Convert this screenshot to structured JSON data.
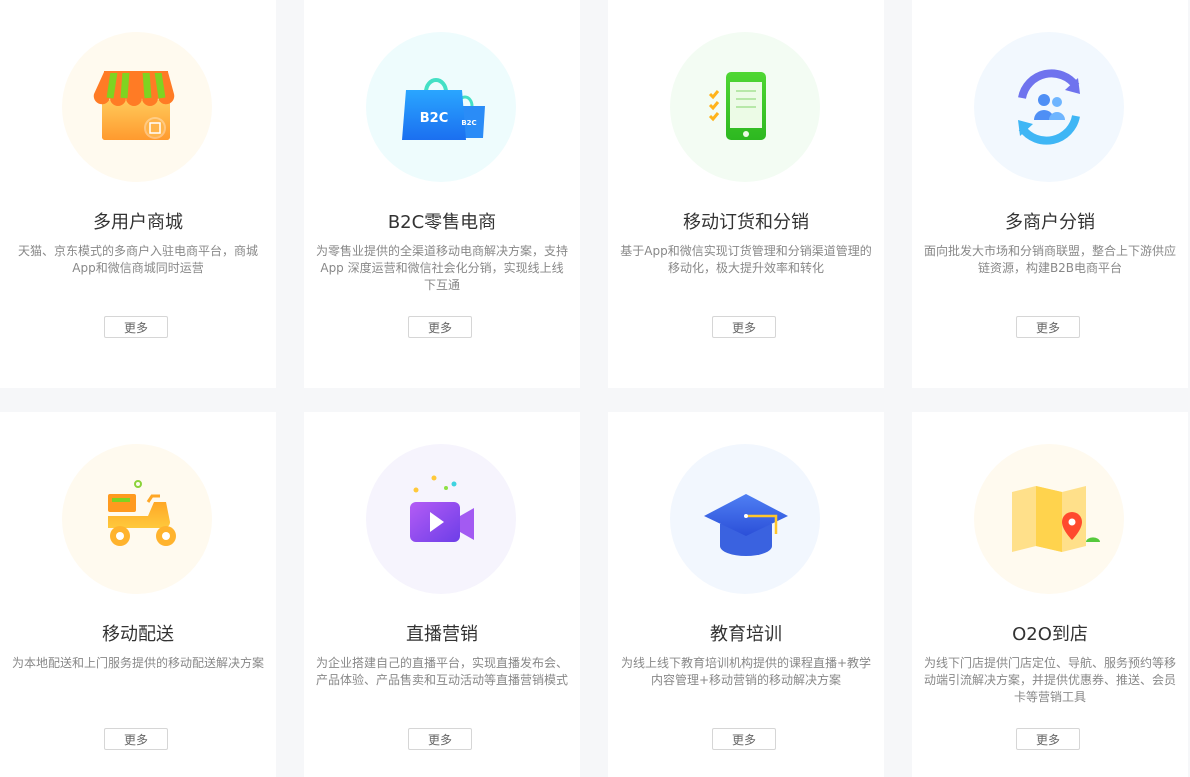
{
  "cards": [
    {
      "title": "多用户商城",
      "description": "天猫、京东模式的多商户入驻电商平台，商城App和微信商城同时运营",
      "more_label": "更多",
      "icon": "storefront-icon",
      "circle_color": "#fffaef"
    },
    {
      "title": "B2C零售电商",
      "description": "为零售业提供的全渠道移动电商解决方案，支持App 深度运营和微信社会化分销，实现线上线下互通",
      "more_label": "更多",
      "icon": "shopping-bag-icon",
      "icon_text": [
        "B2C",
        "B2C"
      ],
      "circle_color": "#eefcfd"
    },
    {
      "title": "移动订货和分销",
      "description": "基于App和微信实现订货管理和分销渠道管理的移动化，极大提升效率和转化",
      "more_label": "更多",
      "icon": "mobile-checklist-icon",
      "circle_color": "#f3fcf3"
    },
    {
      "title": "多商户分销",
      "description": "面向批发大市场和分销商联盟，整合上下游供应链资源，构建B2B电商平台",
      "more_label": "更多",
      "icon": "users-cycle-icon",
      "circle_color": "#f2f8fe"
    },
    {
      "title": "移动配送",
      "description": "为本地配送和上门服务提供的移动配送解决方案",
      "more_label": "更多",
      "icon": "scooter-icon",
      "circle_color": "#fffaef"
    },
    {
      "title": "直播营销",
      "description": "为企业搭建自己的直播平台，实现直播发布会、产品体验、产品售卖和互动活动等直播营销模式",
      "more_label": "更多",
      "icon": "video-camera-icon",
      "circle_color": "#f6f4fd"
    },
    {
      "title": "教育培训",
      "description": "为线上线下教育培训机构提供的课程直播+教学内容管理+移动营销的移动解决方案",
      "more_label": "更多",
      "icon": "graduation-cap-icon",
      "circle_color": "#f2f7fe"
    },
    {
      "title": "O2O到店",
      "description": "为线下门店提供门店定位、导航、服务预约等移动端引流解决方案，并提供优惠券、推送、会员卡等营销工具",
      "more_label": "更多",
      "icon": "map-pin-icon",
      "circle_color": "#fffaef"
    }
  ]
}
